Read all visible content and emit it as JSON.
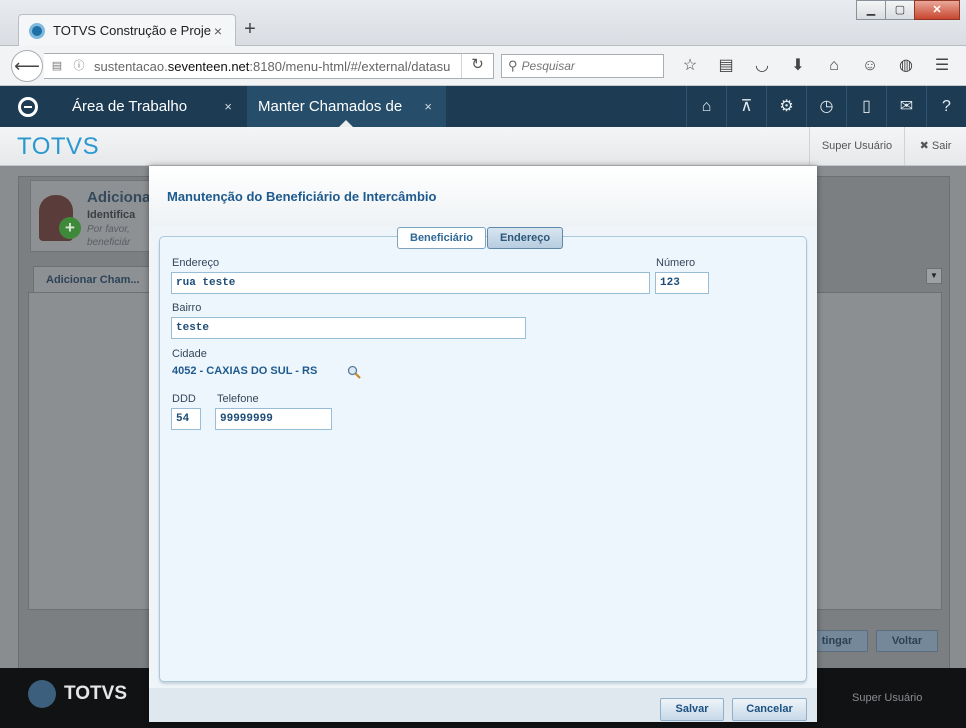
{
  "browser": {
    "tab_title": "TOTVS Construção e Projet...",
    "tab_close": "×",
    "new_tab": "+",
    "url_prefix": "sustentacao.",
    "url_domain": "seventeen.net",
    "url_rest": ":8180/menu-html/#/external/datasu",
    "search_placeholder": "Pesquisar",
    "window_buttons": [
      "▁",
      "▢",
      "✕"
    ]
  },
  "app": {
    "tabs": [
      {
        "label": "Área de Trabalho",
        "close": "×"
      },
      {
        "label": "Manter Chamados de",
        "close": "×"
      }
    ],
    "brand": "TOTVS",
    "user": "Super Usuário",
    "logout": "Sair"
  },
  "background": {
    "info_title": "Adiciona",
    "info_sub": "Identifica",
    "info_text1": "Por favor, ",
    "info_text2": "beneficiár",
    "tab_label": "Adicionar Cham...",
    "btn_partial": "tingar",
    "btn_back": "Voltar",
    "footer_brand": "TOTVS",
    "footer_user": "Super Usuário"
  },
  "modal": {
    "title": "Manutenção do Beneficiário de Intercâmbio",
    "tabs": [
      "Beneficiário",
      "Endereço"
    ],
    "active_tab": "Endereço",
    "fields": {
      "endereco_label": "Endereço",
      "endereco_value": "rua teste",
      "numero_label": "Número",
      "numero_value": "123",
      "bairro_label": "Bairro",
      "bairro_value": "teste",
      "cidade_label": "Cidade",
      "cidade_value": "4052 - CAXIAS DO SUL - RS",
      "ddd_label": "DDD",
      "ddd_value": "54",
      "telefone_label": "Telefone",
      "telefone_value": "99999999"
    },
    "buttons": {
      "save": "Salvar",
      "cancel": "Cancelar"
    }
  },
  "colors": {
    "app_header": "#1d3b52",
    "brand": "#2a99d0",
    "modal_title": "#1e5a8e"
  }
}
